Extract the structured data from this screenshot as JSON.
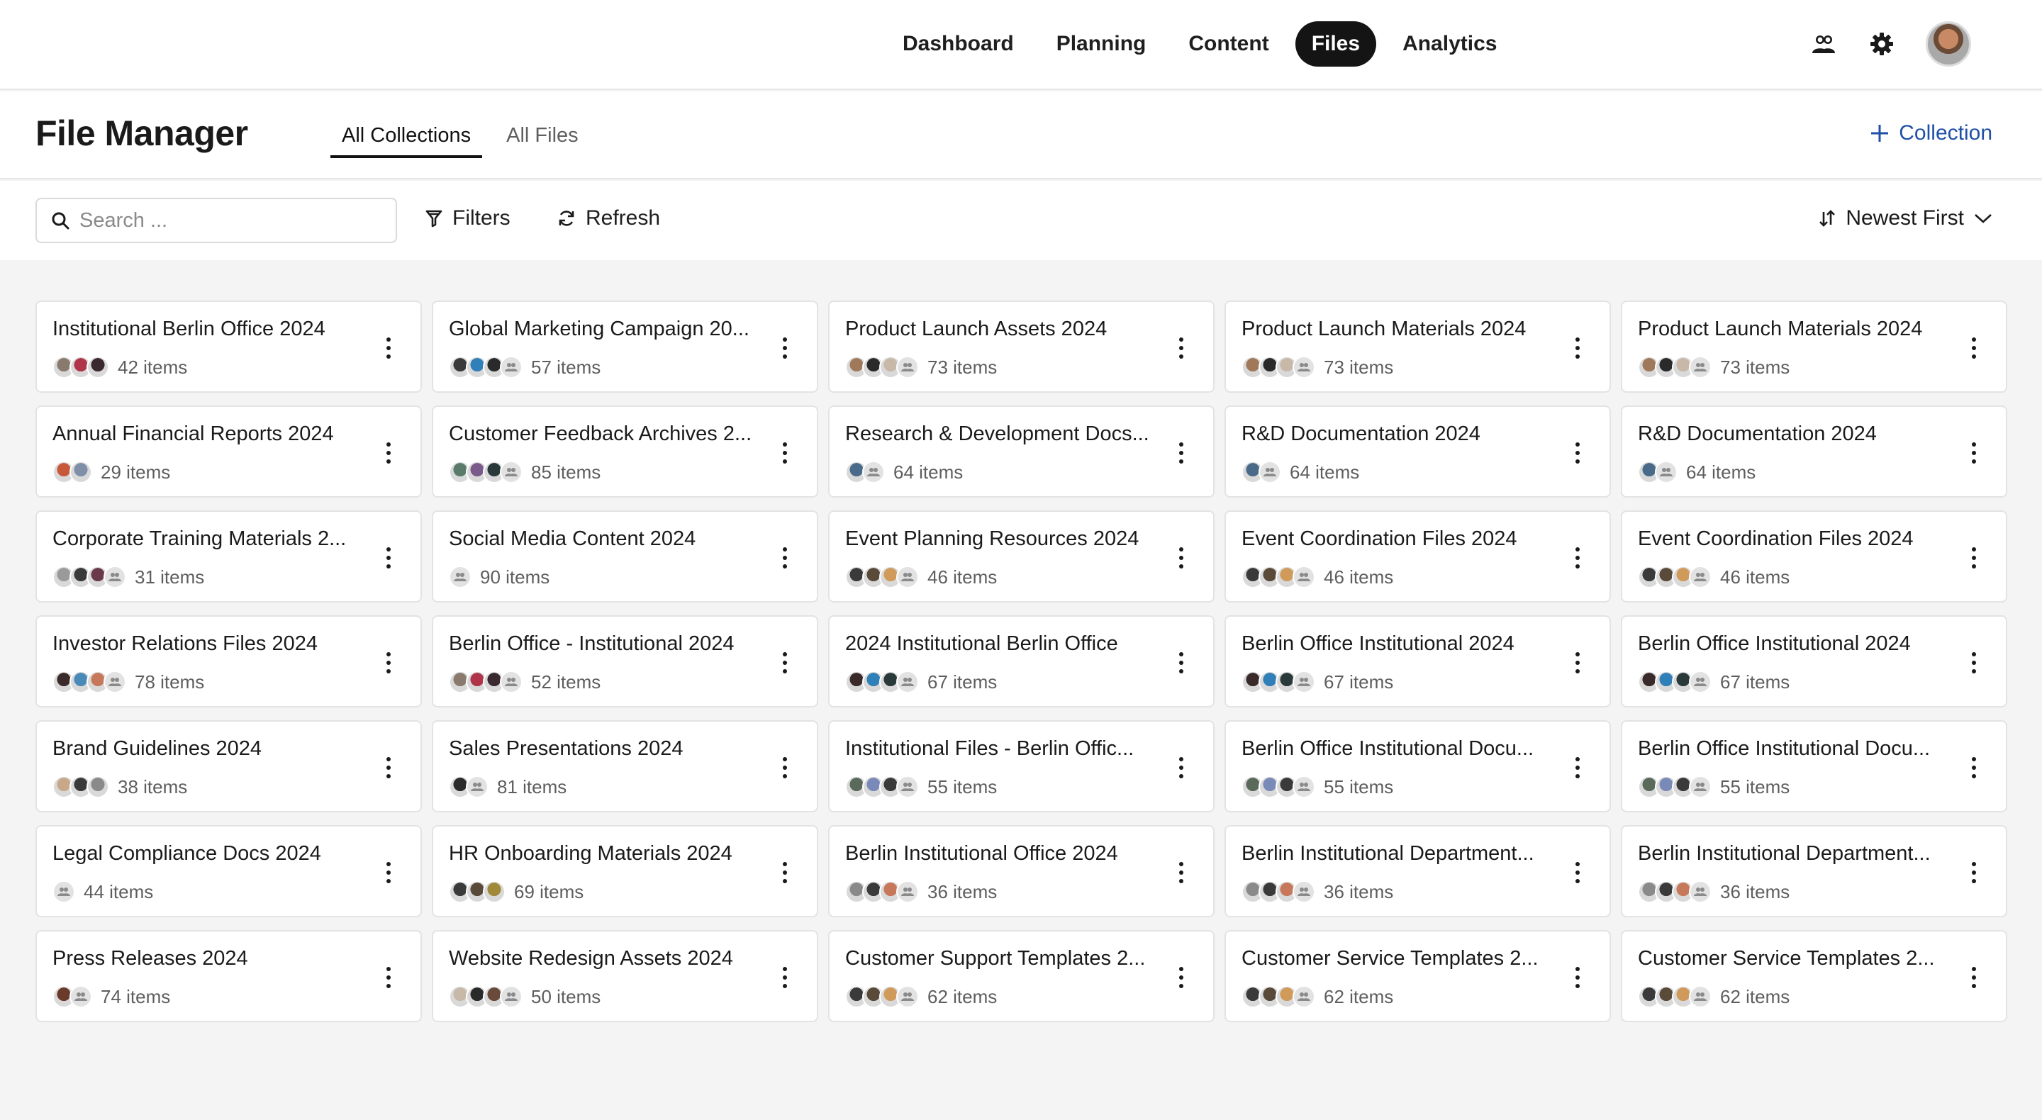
{
  "nav": {
    "items": [
      {
        "label": "Dashboard",
        "active": false
      },
      {
        "label": "Planning",
        "active": false
      },
      {
        "label": "Content",
        "active": false
      },
      {
        "label": "Files",
        "active": true
      },
      {
        "label": "Analytics",
        "active": false
      }
    ],
    "icons": [
      "users-icon",
      "gear-icon",
      "user-avatar"
    ]
  },
  "header": {
    "title": "File Manager",
    "tabs": [
      {
        "label": "All Collections",
        "active": true
      },
      {
        "label": "All Files",
        "active": false
      }
    ],
    "add_collection_label": "Collection"
  },
  "toolbar": {
    "search_placeholder": "Search ...",
    "filters_label": "Filters",
    "refresh_label": "Refresh",
    "sort_label": "Newest First"
  },
  "colors": {
    "accent_link": "#1f4fa8",
    "active_nav_bg": "#141414"
  },
  "collections": [
    {
      "title": "Institutional Berlin Office 2024",
      "count": "42 items",
      "avatars": [
        "#8a7a6e",
        "#b0344a",
        "#3a2a30"
      ],
      "group": false
    },
    {
      "title": "Global Marketing Campaign 20...",
      "count": "57 items",
      "avatars": [
        "#3b3b3b",
        "#2f7fb8",
        "#2a2a2a"
      ],
      "group": true
    },
    {
      "title": "Product Launch Assets 2024",
      "count": "73 items",
      "avatars": [
        "#a0785a",
        "#2a2a2a",
        "#c8b8a8"
      ],
      "group": true
    },
    {
      "title": "Product Launch Materials 2024",
      "count": "73 items",
      "avatars": [
        "#a0785a",
        "#2a2a2a",
        "#c8b8a8"
      ],
      "group": true
    },
    {
      "title": "Product Launch Materials 2024",
      "count": "73 items",
      "avatars": [
        "#a0785a",
        "#2a2a2a",
        "#c8b8a8"
      ],
      "group": true
    },
    {
      "title": "Annual Financial Reports 2024",
      "count": "29 items",
      "avatars": [
        "#c8583a",
        "#7f8fa8"
      ],
      "group": false
    },
    {
      "title": "Customer Feedback Archives 2...",
      "count": "85 items",
      "avatars": [
        "#5a7a6a",
        "#7a5a8a",
        "#2a3a3a"
      ],
      "group": true
    },
    {
      "title": "Research & Development Docs...",
      "count": "64 items",
      "avatars": [
        "#4a6a8a"
      ],
      "group": true
    },
    {
      "title": "R&D Documentation 2024",
      "count": "64 items",
      "avatars": [
        "#4a6a8a"
      ],
      "group": true
    },
    {
      "title": "R&D Documentation 2024",
      "count": "64 items",
      "avatars": [
        "#4a6a8a"
      ],
      "group": true
    },
    {
      "title": "Corporate Training Materials 2...",
      "count": "31 items",
      "avatars": [
        "#9a9a9a",
        "#3a3a3a",
        "#6a3a4a"
      ],
      "group": true
    },
    {
      "title": "Social Media Content 2024",
      "count": "90 items",
      "avatars": [],
      "group": true
    },
    {
      "title": "Event Planning Resources 2024",
      "count": "46 items",
      "avatars": [
        "#3a3a3a",
        "#5a4a3a",
        "#d09a5a"
      ],
      "group": true
    },
    {
      "title": "Event Coordination Files 2024",
      "count": "46 items",
      "avatars": [
        "#3a3a3a",
        "#5a4a3a",
        "#d09a5a"
      ],
      "group": true
    },
    {
      "title": "Event Coordination Files 2024",
      "count": "46 items",
      "avatars": [
        "#3a3a3a",
        "#5a4a3a",
        "#d09a5a"
      ],
      "group": true
    },
    {
      "title": "Investor Relations Files 2024",
      "count": "78 items",
      "avatars": [
        "#3a2a2a",
        "#4a8ab8",
        "#c8785a"
      ],
      "group": true
    },
    {
      "title": "Berlin Office - Institutional 2024",
      "count": "52 items",
      "avatars": [
        "#8a7a6e",
        "#b0344a",
        "#3a2a30"
      ],
      "group": true
    },
    {
      "title": "2024 Institutional Berlin Office",
      "count": "67 items",
      "avatars": [
        "#3a2a2a",
        "#2f7fb8",
        "#2a3a3a"
      ],
      "group": true
    },
    {
      "title": "Berlin Office Institutional 2024",
      "count": "67 items",
      "avatars": [
        "#3a2a2a",
        "#2f7fb8",
        "#2a3a3a"
      ],
      "group": true
    },
    {
      "title": "Berlin Office Institutional 2024",
      "count": "67 items",
      "avatars": [
        "#3a2a2a",
        "#2f7fb8",
        "#2a3a3a"
      ],
      "group": true
    },
    {
      "title": "Brand Guidelines 2024",
      "count": "38 items",
      "avatars": [
        "#c8a888",
        "#3a3a3a",
        "#8a8a8a"
      ],
      "group": false
    },
    {
      "title": "Sales Presentations 2024",
      "count": "81 items",
      "avatars": [
        "#2a2a2a"
      ],
      "group": true
    },
    {
      "title": "Institutional Files - Berlin Offic...",
      "count": "55 items",
      "avatars": [
        "#5a6a5a",
        "#7a8ab8",
        "#3a3a3a"
      ],
      "group": true
    },
    {
      "title": "Berlin Office Institutional Docu...",
      "count": "55 items",
      "avatars": [
        "#5a6a5a",
        "#7a8ab8",
        "#3a3a3a"
      ],
      "group": true
    },
    {
      "title": "Berlin Office Institutional Docu...",
      "count": "55 items",
      "avatars": [
        "#5a6a5a",
        "#7a8ab8",
        "#3a3a3a"
      ],
      "group": true
    },
    {
      "title": "Legal Compliance Docs 2024",
      "count": "44 items",
      "avatars": [],
      "group": true
    },
    {
      "title": "HR Onboarding Materials 2024",
      "count": "69 items",
      "avatars": [
        "#3a3a3a",
        "#5a4a3a",
        "#a08a3a"
      ],
      "group": false
    },
    {
      "title": "Berlin Institutional Office 2024",
      "count": "36 items",
      "avatars": [
        "#8a8a8a",
        "#3a3a3a",
        "#c8785a"
      ],
      "group": true
    },
    {
      "title": "Berlin Institutional Department...",
      "count": "36 items",
      "avatars": [
        "#8a8a8a",
        "#3a3a3a",
        "#c8785a"
      ],
      "group": true
    },
    {
      "title": "Berlin Institutional Department...",
      "count": "36 items",
      "avatars": [
        "#8a8a8a",
        "#3a3a3a",
        "#c8785a"
      ],
      "group": true
    },
    {
      "title": "Press Releases 2024",
      "count": "74 items",
      "avatars": [
        "#6a3a2a"
      ],
      "group": true
    },
    {
      "title": "Website Redesign Assets 2024",
      "count": "50 items",
      "avatars": [
        "#c8b8a8",
        "#2a2a2a",
        "#6a4a3a"
      ],
      "group": true
    },
    {
      "title": "Customer Support Templates 2...",
      "count": "62 items",
      "avatars": [
        "#3a3a3a",
        "#5a4a3a",
        "#d09a5a"
      ],
      "group": true
    },
    {
      "title": "Customer Service Templates 2...",
      "count": "62 items",
      "avatars": [
        "#3a3a3a",
        "#5a4a3a",
        "#d09a5a"
      ],
      "group": true
    },
    {
      "title": "Customer Service Templates 2...",
      "count": "62 items",
      "avatars": [
        "#3a3a3a",
        "#5a4a3a",
        "#d09a5a"
      ],
      "group": true
    }
  ]
}
